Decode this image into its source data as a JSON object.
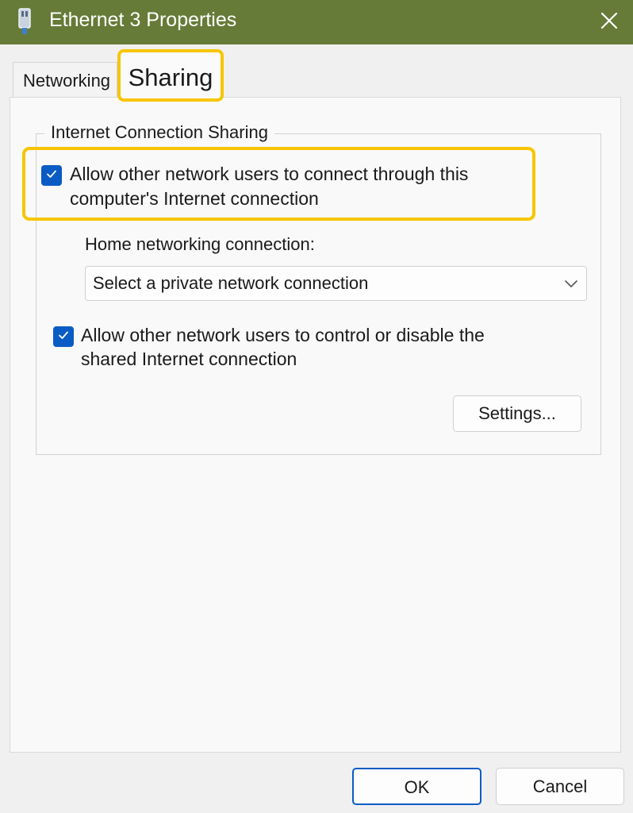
{
  "window": {
    "title": "Ethernet 3 Properties",
    "icon": "network-adapter-icon",
    "close_icon": "close-icon"
  },
  "tabs": [
    {
      "label": "Networking",
      "selected": false
    },
    {
      "label": "Sharing",
      "selected": true
    }
  ],
  "sharing": {
    "group_title": "Internet Connection Sharing",
    "allow_connect": {
      "line1": "Allow other network users to connect through this",
      "line2": "computer's Internet connection",
      "checked": true
    },
    "home_label": "Home networking connection:",
    "home_select_value": "Select a private network connection",
    "allow_control": {
      "line1": "Allow other network users to control or disable the",
      "line2": "shared Internet connection",
      "checked": true
    },
    "settings_label": "Settings..."
  },
  "footer": {
    "ok_label": "OK",
    "cancel_label": "Cancel"
  },
  "colors": {
    "titlebar": "#657b37",
    "accent": "#0a5bc4",
    "highlight": "#f7c600"
  }
}
